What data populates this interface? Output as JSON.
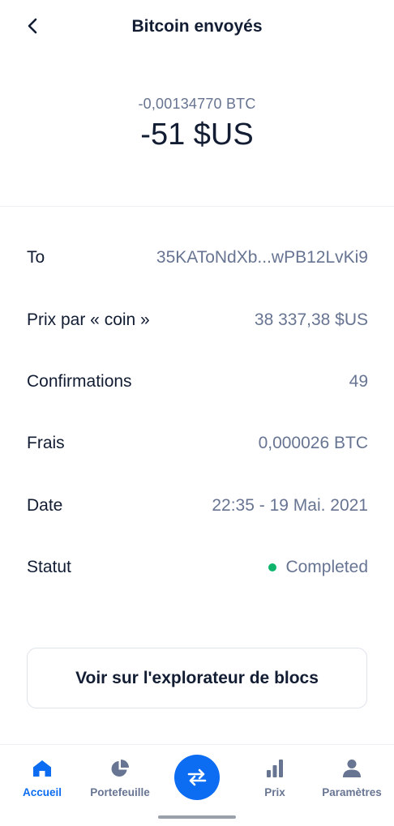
{
  "header": {
    "title": "Bitcoin envoyés",
    "back_icon": "chevron-left-icon"
  },
  "amount": {
    "crypto": "-0,00134770 BTC",
    "fiat": "-51 $US"
  },
  "details": [
    {
      "label": "To",
      "value": "35KAToNdXb...wPB12LvKi9"
    },
    {
      "label": "Prix par « coin »",
      "value": "38 337,38 $US"
    },
    {
      "label": "Confirmations",
      "value": "49"
    },
    {
      "label": "Frais",
      "value": "0,000026 BTC"
    },
    {
      "label": "Date",
      "value": "22:35 - 19 Mai. 2021"
    },
    {
      "label": "Statut",
      "value": "Completed",
      "status_color": "#10b36b"
    }
  ],
  "explorer_button": {
    "label": "Voir sur l'explorateur de blocs"
  },
  "nav": {
    "items": [
      {
        "label": "Accueil",
        "icon": "home-icon",
        "active": true
      },
      {
        "label": "Portefeuille",
        "icon": "pie-chart-icon",
        "active": false
      },
      {
        "label": "Prix",
        "icon": "bar-chart-icon",
        "active": false
      },
      {
        "label": "Paramètres",
        "icon": "user-icon",
        "active": false
      }
    ],
    "swap_icon": "swap-arrows-icon"
  },
  "colors": {
    "accent": "#0c6cf2",
    "text": "#121d33",
    "muted": "#677492",
    "status_green": "#10b36b"
  }
}
